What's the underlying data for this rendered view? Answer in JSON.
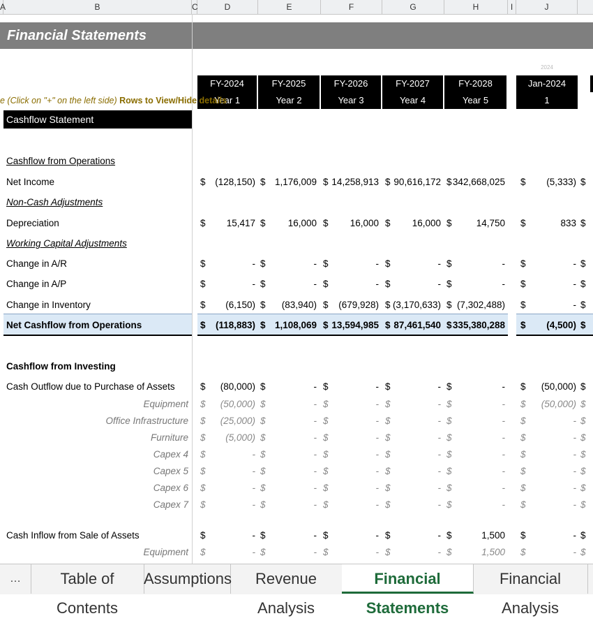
{
  "columns": [
    "A",
    "B",
    "C",
    "D",
    "E",
    "F",
    "G",
    "H",
    "I",
    "J"
  ],
  "title": "Financial Statements",
  "note_prefix": "e (Click on \"+\" on the left side)",
  "note_suffix": "Rows to View/Hide details",
  "headers": {
    "fy": [
      "FY-2024",
      "FY-2025",
      "FY-2026",
      "FY-2027",
      "FY-2028"
    ],
    "years": [
      "Year 1",
      "Year 2",
      "Year 3",
      "Year 4",
      "Year 5"
    ],
    "month_year": "2024",
    "month": "Jan-2024",
    "month_num": "1"
  },
  "section": "Cashflow Statement",
  "labels": {
    "cfo": "Cashflow from Operations",
    "net_income": "Net Income",
    "non_cash": "Non-Cash Adjustments",
    "depreciation": "Depreciation",
    "wc": "Working Capital Adjustments",
    "ar": "Change in A/R",
    "ap": "Change in A/P",
    "inv": "Change in Inventory",
    "net_cfo": "Net Cashflow from Operations",
    "cfi": "Cashflow from Investing",
    "outflow": "Cash Outflow due to Purchase of Assets",
    "equipment": "Equipment",
    "office": "Office Infrastructure",
    "furniture": "Furniture",
    "capex4": "Capex 4",
    "capex5": "Capex 5",
    "capex6": "Capex 6",
    "capex7": "Capex 7",
    "inflow": "Cash Inflow from Sale of Assets",
    "equipment2": "Equipment"
  },
  "rows": {
    "net_income": [
      "(128,150)",
      "1,176,009",
      "14,258,913",
      "90,616,172",
      "342,668,025",
      "(5,333)"
    ],
    "depreciation": [
      "15,417",
      "16,000",
      "16,000",
      "16,000",
      "14,750",
      "833"
    ],
    "ar": [
      "-",
      "-",
      "-",
      "-",
      "-",
      "-"
    ],
    "ap": [
      "-",
      "-",
      "-",
      "-",
      "-",
      "-"
    ],
    "inv": [
      "(6,150)",
      "(83,940)",
      "(679,928)",
      "(3,170,633)",
      "(7,302,488)",
      "-"
    ],
    "net_cfo": [
      "(118,883)",
      "1,108,069",
      "13,594,985",
      "87,461,540",
      "335,380,288",
      "(4,500)"
    ],
    "outflow": [
      "(80,000)",
      "-",
      "-",
      "-",
      "-",
      "(50,000)"
    ],
    "equipment": [
      "(50,000)",
      "-",
      "-",
      "-",
      "-",
      "(50,000)"
    ],
    "office": [
      "(25,000)",
      "-",
      "-",
      "-",
      "-",
      "-"
    ],
    "furniture": [
      "(5,000)",
      "-",
      "-",
      "-",
      "-",
      "-"
    ],
    "capex4": [
      "-",
      "-",
      "-",
      "-",
      "-",
      "-"
    ],
    "capex5": [
      "-",
      "-",
      "-",
      "-",
      "-",
      "-"
    ],
    "capex6": [
      "-",
      "-",
      "-",
      "-",
      "-",
      "-"
    ],
    "capex7": [
      "-",
      "-",
      "-",
      "-",
      "-",
      "-"
    ],
    "inflow": [
      "-",
      "-",
      "-",
      "-",
      "1,500",
      "-"
    ],
    "equipment2": [
      "-",
      "-",
      "-",
      "-",
      "1,500",
      "-"
    ]
  },
  "currency": "$",
  "tabs": [
    "Table of Contents",
    "Assumptions",
    "Revenue Analysis",
    "Financial Statements",
    "Financial Analysis"
  ],
  "active_tab": "Financial Statements"
}
